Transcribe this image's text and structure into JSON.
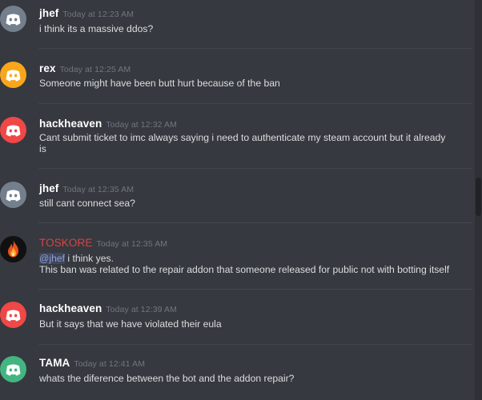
{
  "messages": [
    {
      "author": "jhef",
      "timestamp": "Today at 12:23 AM",
      "avatar_color": "#747f8d",
      "avatar_icon": "discord-logo-icon",
      "lines": [
        "i think its a massive ddos?"
      ]
    },
    {
      "author": "rex",
      "timestamp": "Today at 12:25 AM",
      "avatar_color": "#faa61a",
      "avatar_icon": "discord-logo-icon",
      "lines": [
        "Someone might have been butt hurt because of the ban"
      ]
    },
    {
      "author": "hackheaven",
      "timestamp": "Today at 12:32 AM",
      "avatar_color": "#f04747",
      "avatar_icon": "discord-logo-icon",
      "lines": [
        "Cant submit ticket to imc always saying i need to authenticate my steam account but it already",
        "is"
      ]
    },
    {
      "author": "jhef",
      "timestamp": "Today at 12:35 AM",
      "avatar_color": "#747f8d",
      "avatar_icon": "discord-logo-icon",
      "lines": [
        "still cant connect sea?"
      ]
    },
    {
      "author": "TOSKORE",
      "author_color": "#d64545",
      "timestamp": "Today at 12:35 AM",
      "avatar_color": "#111111",
      "avatar_icon": "flame-icon",
      "mention": "@jhef",
      "lines": [
        " i think yes.",
        "This ban was related to the repair addon that someone released for public not with botting itself"
      ]
    },
    {
      "author": "hackheaven",
      "timestamp": "Today at 12:39 AM",
      "avatar_color": "#f04747",
      "avatar_icon": "discord-logo-icon",
      "lines": [
        "But it says that we have violated their eula"
      ]
    },
    {
      "author": "TAMA",
      "timestamp": "Today at 12:41 AM",
      "avatar_color": "#43b581",
      "avatar_icon": "discord-logo-icon",
      "lines": [
        "whats the diference between the bot and the addon repair?"
      ]
    }
  ]
}
